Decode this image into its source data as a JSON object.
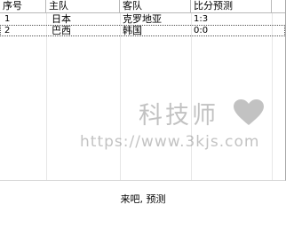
{
  "table": {
    "columns": [
      "序号",
      "主队",
      "客队",
      "比分预测"
    ],
    "rows": [
      {
        "index": "1",
        "home": "日本",
        "away": "克罗地亚",
        "score": "1:3"
      },
      {
        "index": "2",
        "home": "巴西",
        "away": "韩国",
        "score": "0:0"
      }
    ]
  },
  "status_text": "来吧, 预测",
  "watermark": {
    "title": "科技师",
    "url": "https://www.3kjs.com",
    "heart_color": "#7a7a7a"
  }
}
